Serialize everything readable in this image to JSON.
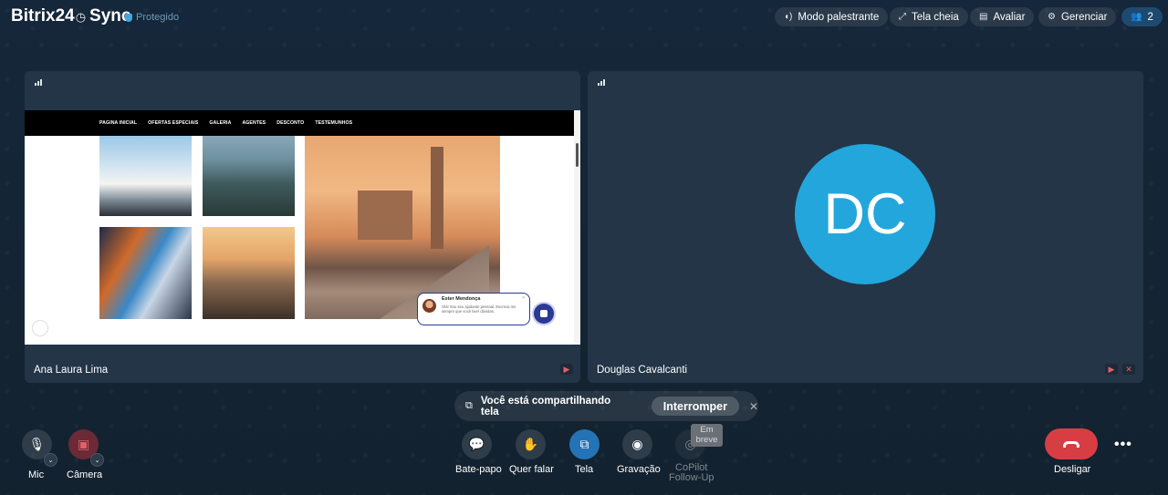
{
  "header": {
    "logo_text": "Bitrix24",
    "logo_product": "Sync",
    "protected_label": "Protegido",
    "buttons": [
      {
        "label": "Modo palestrante",
        "icon": "speaker-mode-icon"
      },
      {
        "label": "Tela cheia",
        "icon": "fullscreen-icon"
      },
      {
        "label": "Avaliar",
        "icon": "feedback-icon"
      },
      {
        "label": "Gerenciar",
        "icon": "gear-icon"
      }
    ],
    "participants_count": "2"
  },
  "tiles": [
    {
      "name": "Ana Laura Lima",
      "shared_site": {
        "nav": [
          "PAGINA INICIAL",
          "OFERTAS ESPECIAIS",
          "GALERIA",
          "AGENTES",
          "DESCONTO",
          "TESTEMUNHOS"
        ],
        "chat_title": "Ester Mendonça",
        "chat_text": "Olá! Sou seu ajudante pessoal. Escreva me sempre que você tiver dúvidas."
      }
    },
    {
      "name": "Douglas Cavalcanti",
      "initials": "DC"
    }
  ],
  "share_notice": {
    "text": "Você está compartilhando tela",
    "stop_label": "Interromper"
  },
  "controls": {
    "mic": "Mic",
    "camera": "Câmera",
    "chat": "Bate-papo",
    "raise_hand": "Quer falar",
    "screen": "Tela",
    "record": "Gravação",
    "copilot_line1": "CoPilot",
    "copilot_line2": "Follow-Up",
    "copilot_tooltip_line1": "Em",
    "copilot_tooltip_line2": "breve",
    "hangup": "Desligar"
  },
  "colors": {
    "background": "#142433",
    "tile": "#243547",
    "avatar": "#23a6dc",
    "screen_share_active": "#2473b6",
    "hangup": "#d83d44",
    "camera_off": "#6b2a36"
  }
}
